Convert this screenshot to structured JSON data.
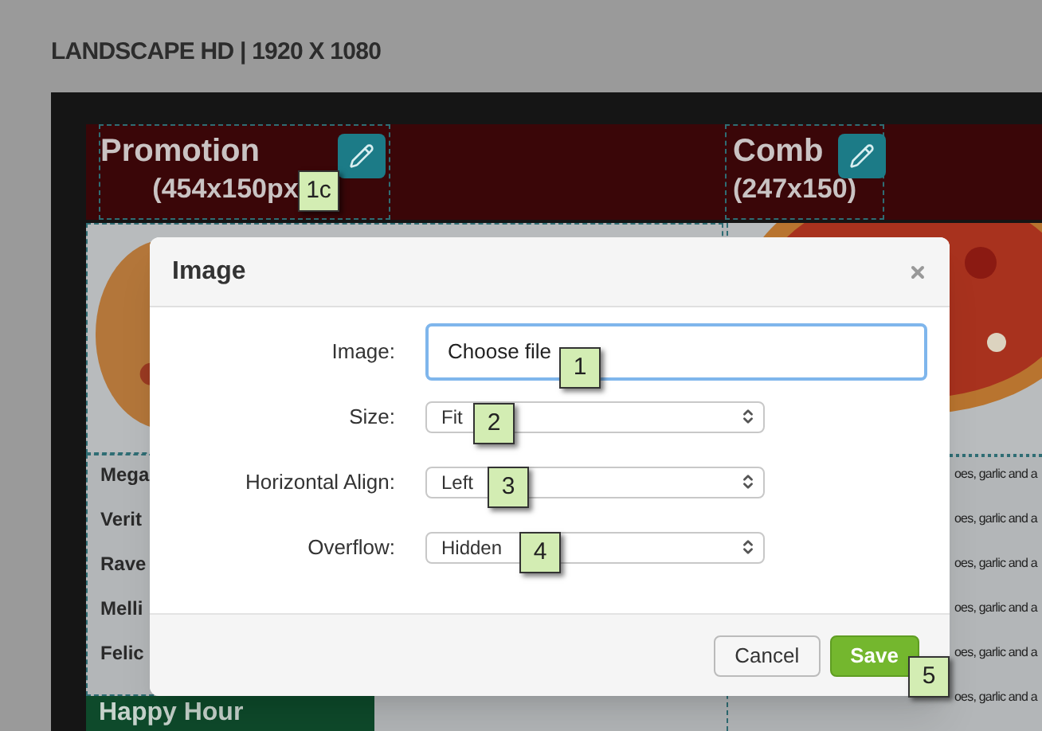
{
  "page_title": "LANDSCAPE HD | 1920 X 1080",
  "banner": [
    {
      "title": "Promotion",
      "size": "(454x150px"
    },
    {
      "title": "Comb",
      "size": "(247x150)"
    }
  ],
  "left_list": [
    "Mega",
    "Verit",
    "Rave",
    "Melli",
    "Felic"
  ],
  "right_list": [
    "oes, garlic and a",
    "oes, garlic and a",
    "oes, garlic and a",
    "oes, garlic and a",
    "oes, garlic and a",
    "oes, garlic and a"
  ],
  "footer_section": {
    "title": "Happy Hour"
  },
  "dialog": {
    "title": "Image",
    "fields": [
      {
        "label": "Image:",
        "kind": "file",
        "value": "Choose file",
        "focused": true
      },
      {
        "label": "Size:",
        "kind": "select",
        "value": "Fit"
      },
      {
        "label": "Horizontal Align:",
        "kind": "select",
        "value": "Left"
      },
      {
        "label": "Overflow:",
        "kind": "select",
        "value": "Hidden"
      }
    ],
    "buttons": [
      {
        "label": "Cancel",
        "kind": "secondary"
      },
      {
        "label": "Save",
        "kind": "primary"
      }
    ]
  },
  "callouts": [
    "1c",
    "1",
    "2",
    "3",
    "4",
    "5"
  ]
}
